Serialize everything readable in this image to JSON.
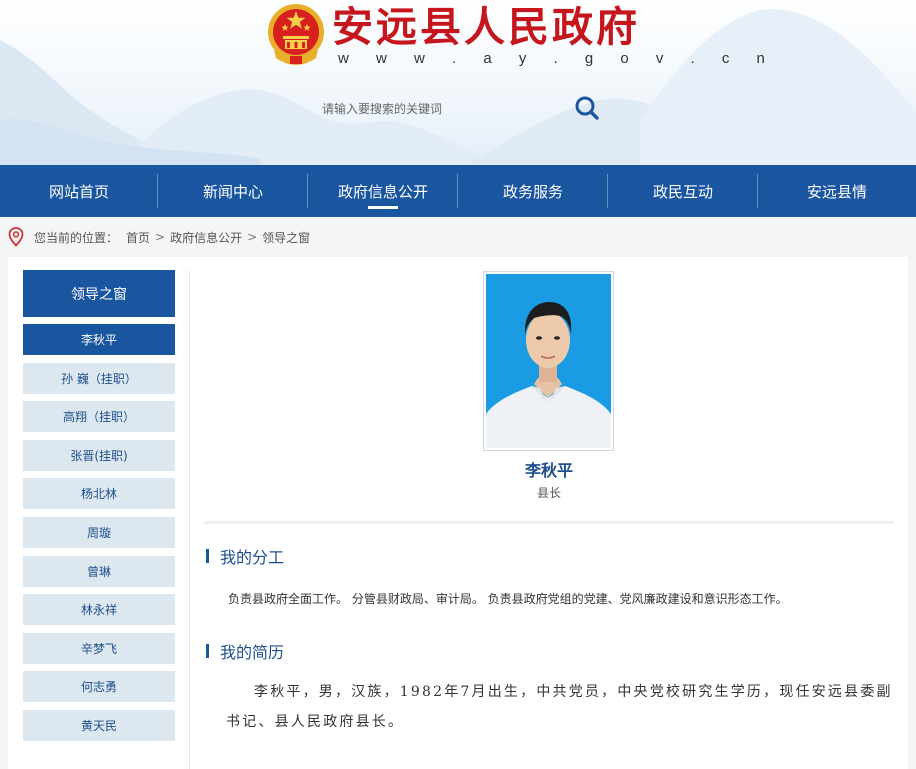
{
  "header": {
    "site_title": "安远县人民政府",
    "site_url": "w w w . a y . g o v . c n",
    "search_placeholder": "请输入要搜索的关键词"
  },
  "nav": {
    "items": [
      {
        "label": "网站首页"
      },
      {
        "label": "新闻中心"
      },
      {
        "label": "政府信息公开",
        "active": true
      },
      {
        "label": "政务服务"
      },
      {
        "label": "政民互动"
      },
      {
        "label": "安远县情"
      }
    ]
  },
  "breadcrumb": {
    "prefix": "您当前的位置：",
    "items": [
      "首页",
      "政府信息公开",
      "领导之窗"
    ],
    "separator": ">"
  },
  "sidebar": {
    "heading": "领导之窗",
    "items": [
      {
        "label": "李秋平",
        "active": true
      },
      {
        "label": "孙 巍（挂职）"
      },
      {
        "label": "高翔（挂职）"
      },
      {
        "label": "张晋(挂职)"
      },
      {
        "label": "杨北林"
      },
      {
        "label": "周璇"
      },
      {
        "label": "曾琳"
      },
      {
        "label": "林永祥"
      },
      {
        "label": "辛梦飞"
      },
      {
        "label": "何志勇"
      },
      {
        "label": "黄天民"
      }
    ]
  },
  "profile": {
    "name": "李秋平",
    "title": "县长",
    "duty_heading": "我的分工",
    "duty_text": "负责县政府全面工作。 分管县财政局、审计局。 负责县政府党组的党建、党风廉政建设和意识形态工作。",
    "resume_heading": "我的简历",
    "resume_text": "李秋平，男，汉族，1982年7月出生，中共党员，中央党校研究生学历，现任安远县委副书记、县人民政府县长。"
  },
  "colors": {
    "brand_blue": "#1a56a0",
    "title_red": "#c4161c",
    "sidebar_item_bg": "#dde7f0"
  }
}
